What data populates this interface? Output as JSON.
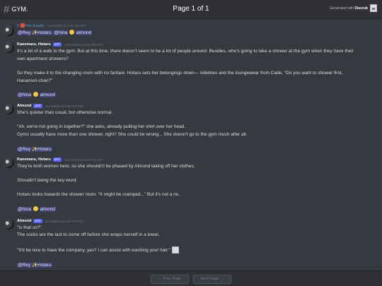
{
  "header": {
    "hash_icon": "#",
    "channel": "GYM.",
    "page_info": "Page 1 of 1",
    "generated_prefix": "Generated with",
    "generated_brand": "Discrub",
    "logo_icon": "broken-image-icon"
  },
  "messages": [
    {
      "author_prefix": "II",
      "author_tag": "five (kazik)",
      "timestamp": "11/16/2025 at 6:26 PM PST",
      "lines": [
        {
          "m1": "@Rey ✨Hotaru",
          "m2": "@hina",
          "m3": "almond"
        }
      ]
    },
    {
      "author": "Kanemaru, Hotaru",
      "badge": "APP",
      "timestamp": "11/16/2025 at 6:52 PM PST",
      "l1": "It's a bit of a walk to the gym. But at this time, there doesn't seem to be a lot of people around. Besides, who's going to take a shower at the gym when they have their",
      "l2": "own apartment showers?",
      "l3": "So they make it to the changing room with no fanfare. Hotaru sets her belongings down— toiletries and the loungewear from Cade. “Do you want to shower first,",
      "l4": "Hanamori-chan?”",
      "m1": "@hina",
      "m2": "almond"
    },
    {
      "author": "Almond",
      "badge": "APP",
      "timestamp": "11/16/2025 at 6:56 PM PST",
      "l1": "She's quieter than usual, but otherwise normal.",
      "l2": "\"Ah, we're not going in together?\" she asks, already pulling her shirt over her head.",
      "l3": "Gyms usually have more than one shower, right? She could be wrong... She doesn't go to the gym much after all.",
      "m1": "@Rey ✨Hotaru"
    },
    {
      "author": "Kanemaru, Hotaru",
      "badge": "APP",
      "timestamp": "11/16/2025 at 6:59 PM PST",
      "l1": "They're both women here, so she shouldn't be phased by Almond taking off her clothes.",
      "l2": "Shouldn't being the key word.",
      "l3": "Hotaru looks towards the shower room. “It might be cramped...” But it's not a no.",
      "m1": "@hina",
      "m2": "almond"
    },
    {
      "author": "Almond",
      "badge": "APP",
      "timestamp": "11/16/2025 at 6:59 PM PST",
      "l1": "\"Is that so?\"",
      "l2": "The socks are the last to come off before she wraps herself in a towel.",
      "l3": "\"It'd be nice to have the company, yes? I can assist with washing your hair.\"",
      "m1": "@Rey ✨Hotaru"
    }
  ],
  "pager": {
    "prev": "← Prev Page",
    "next": "Next Page →"
  }
}
